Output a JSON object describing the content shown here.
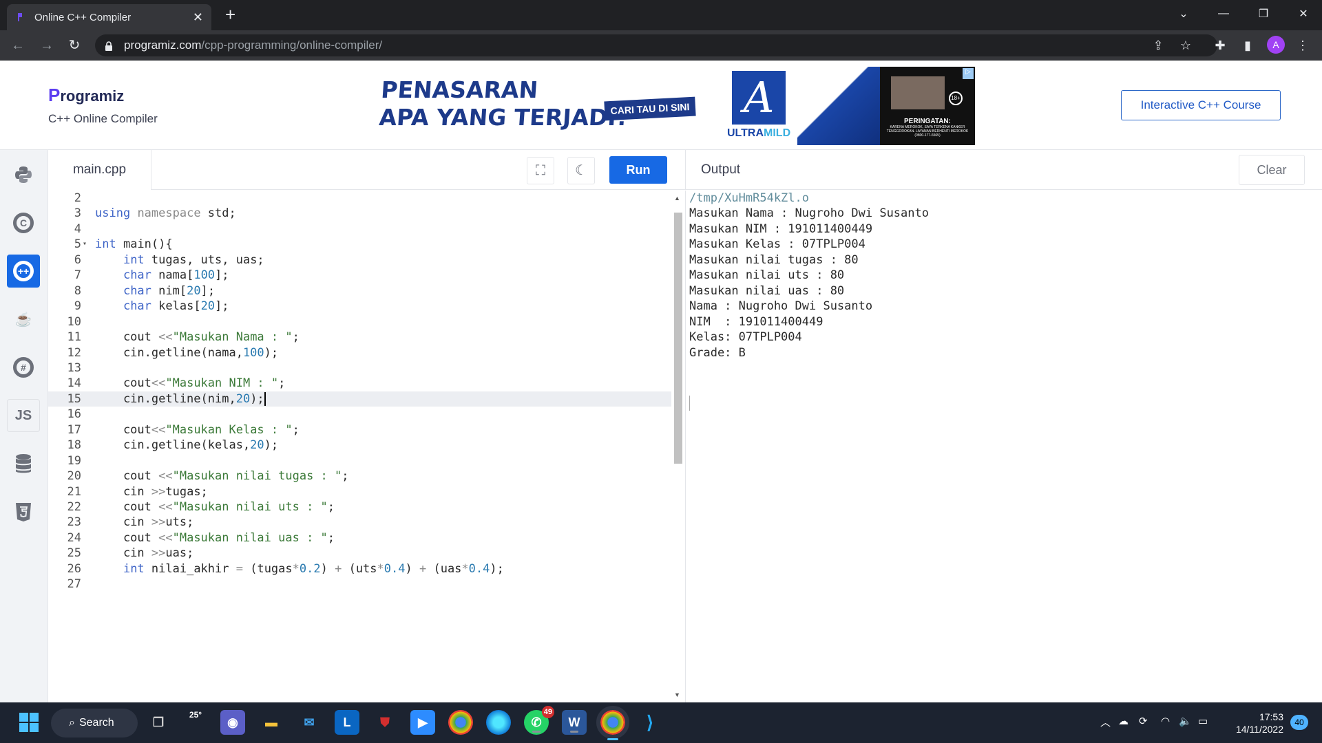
{
  "browser": {
    "tab_title": "Online C++ Compiler",
    "new_tab_icon": "+",
    "url_host": "programiz.com",
    "url_path": "/cpp-programming/online-compiler/",
    "profile_initial": "A"
  },
  "site": {
    "logo_text": "rogramiz",
    "logo_letter": "P",
    "subtitle": "C++ Online Compiler",
    "course_button": "Interactive C++ Course"
  },
  "ad": {
    "headline_line1": "PENASARAN",
    "headline_line2": "APA YANG TERJADI?",
    "cta": "CARI TAU DI SINI",
    "brand_part1": "ULTRA",
    "brand_part2": "MILD",
    "logo_letter": "A",
    "warning_title": "PERINGATAN:",
    "warning_text": "KARENA MEROKOK, SAYA TERKENA KANKER TENGGOROKAN. LAYANAN BERHENTI MEROKOK (0800-177-6565)",
    "age_badge": "18+"
  },
  "editor": {
    "file_name": "main.cpp",
    "run_label": "Run",
    "active_line": 15,
    "lines": [
      {
        "n": "2",
        "html": ""
      },
      {
        "n": "3",
        "html": "<span class=\"kw\">using</span> <span class=\"op\">namespace</span> std;"
      },
      {
        "n": "4",
        "html": ""
      },
      {
        "n": "5",
        "html": "<span class=\"kw\">int</span> main(){",
        "fold": true
      },
      {
        "n": "6",
        "html": "    <span class=\"kw\">int</span> tugas, uts, uas;"
      },
      {
        "n": "7",
        "html": "    <span class=\"kw\">char</span> nama[<span class=\"num\">100</span>];"
      },
      {
        "n": "8",
        "html": "    <span class=\"kw\">char</span> nim[<span class=\"num\">20</span>];"
      },
      {
        "n": "9",
        "html": "    <span class=\"kw\">char</span> kelas[<span class=\"num\">20</span>];"
      },
      {
        "n": "10",
        "html": ""
      },
      {
        "n": "11",
        "html": "    cout <span class=\"op\">&lt;&lt;</span><span class=\"str\">\"Masukan Nama : \"</span>;"
      },
      {
        "n": "12",
        "html": "    cin.getline(nama,<span class=\"num\">100</span>);"
      },
      {
        "n": "13",
        "html": ""
      },
      {
        "n": "14",
        "html": "    cout<span class=\"op\">&lt;&lt;</span><span class=\"str\">\"Masukan NIM : \"</span>;"
      },
      {
        "n": "15",
        "html": "    cin.getline(nim,<span class=\"num\">20</span>);<span class=\"caret\"></span>"
      },
      {
        "n": "16",
        "html": ""
      },
      {
        "n": "17",
        "html": "    cout<span class=\"op\">&lt;&lt;</span><span class=\"str\">\"Masukan Kelas : \"</span>;"
      },
      {
        "n": "18",
        "html": "    cin.getline(kelas,<span class=\"num\">20</span>);"
      },
      {
        "n": "19",
        "html": ""
      },
      {
        "n": "20",
        "html": "    cout <span class=\"op\">&lt;&lt;</span><span class=\"str\">\"Masukan nilai tugas : \"</span>;"
      },
      {
        "n": "21",
        "html": "    cin <span class=\"op\">&gt;&gt;</span>tugas;"
      },
      {
        "n": "22",
        "html": "    cout <span class=\"op\">&lt;&lt;</span><span class=\"str\">\"Masukan nilai uts : \"</span>;"
      },
      {
        "n": "23",
        "html": "    cin <span class=\"op\">&gt;&gt;</span>uts;"
      },
      {
        "n": "24",
        "html": "    cout <span class=\"op\">&lt;&lt;</span><span class=\"str\">\"Masukan nilai uas : \"</span>;"
      },
      {
        "n": "25",
        "html": "    cin <span class=\"op\">&gt;&gt;</span>uas;"
      },
      {
        "n": "26",
        "html": "    <span class=\"kw\">int</span> nilai_akhir <span class=\"op\">=</span> (tugas<span class=\"op\">*</span><span class=\"num\">0.2</span>) <span class=\"op\">+</span> (uts<span class=\"op\">*</span><span class=\"num\">0.4</span>) <span class=\"op\">+</span> (uas<span class=\"op\">*</span><span class=\"num\">0.4</span>);"
      },
      {
        "n": "27",
        "html": ""
      }
    ]
  },
  "output": {
    "title": "Output",
    "clear_label": "Clear",
    "lines": [
      "/tmp/XuHmR54kZl.o",
      "Masukan Nama : Nugroho Dwi Susanto",
      "Masukan NIM : 191011400449",
      "Masukan Kelas : 07TPLP004",
      "Masukan nilai tugas : 80",
      "Masukan nilai uts : 80",
      "Masukan nilai uas : 80",
      "Nama : Nugroho Dwi Susanto",
      "NIM  : 191011400449",
      "Kelas: 07TPLP004",
      "Grade: B"
    ]
  },
  "sidebar": {
    "languages": [
      {
        "name": "python",
        "icon": "python-icon"
      },
      {
        "name": "c",
        "icon": "c-icon"
      },
      {
        "name": "cpp",
        "icon": "cpp-icon",
        "active": true
      },
      {
        "name": "java",
        "icon": "java-icon"
      },
      {
        "name": "csharp",
        "icon": "csharp-icon"
      },
      {
        "name": "javascript",
        "icon": "js-icon",
        "label": "JS"
      },
      {
        "name": "sql",
        "icon": "database-icon"
      },
      {
        "name": "html",
        "icon": "html5-icon"
      }
    ]
  },
  "taskbar": {
    "search_label": "Search",
    "weather_temp": "25°",
    "whatsapp_badge": "49",
    "clock_time": "17:53",
    "clock_date": "14/11/2022",
    "notification_count": "40"
  },
  "colors": {
    "accent": "#1769e4",
    "chrome_dark": "#202124",
    "taskbar": "#1c2330"
  }
}
